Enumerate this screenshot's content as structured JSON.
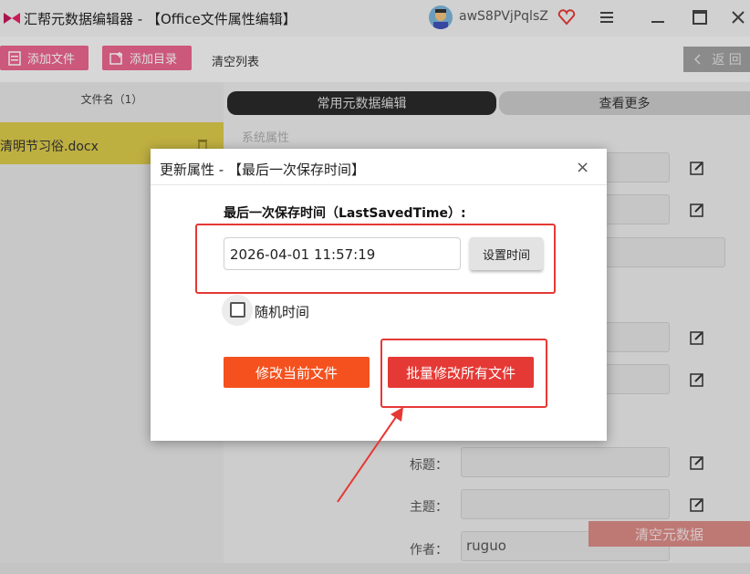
{
  "app": {
    "title": "汇帮元数据编辑器 - 【Office文件属性编辑】",
    "username": "awS8PVjPqlsZ"
  },
  "toolbar": {
    "add_file": "添加文件",
    "add_folder": "添加目录",
    "clear_list": "清空列表",
    "back": "返 回"
  },
  "file_list": {
    "header": "文件名（1）",
    "files": [
      "清明节习俗.docx"
    ]
  },
  "tabs": {
    "common": "常用元数据编辑",
    "more": "查看更多"
  },
  "section": {
    "system_props": "系统属性"
  },
  "fields": {
    "title_label": "标题：",
    "subject_label": "主题：",
    "author_label": "作者：",
    "author_value": "ruguo"
  },
  "clear_metadata": "清空元数据",
  "dialog": {
    "title": "更新属性 - 【最后一次保存时间】",
    "label": "最后一次保存时间（LastSavedTime）:",
    "date_value": "2026-04-01 11:57:19",
    "set_time": "设置时间",
    "random_time": "随机时间",
    "modify_current": "修改当前文件",
    "modify_all": "批量修改所有文件"
  },
  "colors": {
    "accent_red": "#e53935",
    "accent_orange": "#f4511e",
    "file_highlight": "#d9c84a"
  }
}
